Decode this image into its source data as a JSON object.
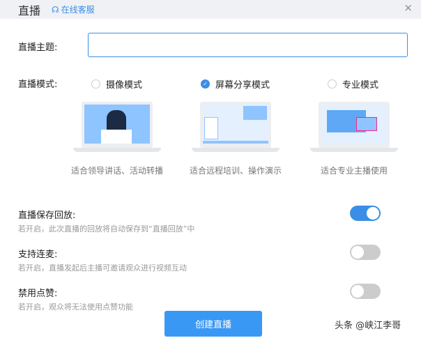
{
  "header": {
    "title": "直播",
    "service_label": "在线客服",
    "close": "×"
  },
  "form": {
    "topic_label": "直播主题:",
    "topic_value": "",
    "mode_label": "直播模式:",
    "modes": [
      {
        "label": "摄像模式",
        "selected": false,
        "caption": "适合领导讲话、活动转播"
      },
      {
        "label": "屏幕分享模式",
        "selected": true,
        "caption": "适合远程培训、操作演示"
      },
      {
        "label": "专业模式",
        "selected": false,
        "caption": "适合专业主播使用"
      }
    ],
    "options": [
      {
        "title": "直播保存回放:",
        "desc": "若开启，此次直播的回放将自动保存到“直播回放”中",
        "on": true
      },
      {
        "title": "支持连麦:",
        "desc": "若开启，直播发起后主播可邀请观众进行视频互动",
        "on": false
      },
      {
        "title": "禁用点赞:",
        "desc": "若开启，观众将无法使用点赞功能",
        "on": false
      }
    ],
    "submit": "创建直播"
  },
  "watermark": "头条 @峡江李哥",
  "colors": {
    "accent": "#3a8ee6",
    "header_bg": "#f0f1f5"
  }
}
